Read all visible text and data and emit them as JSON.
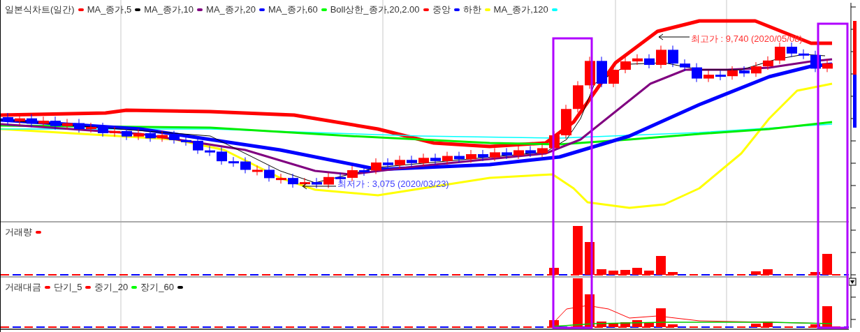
{
  "price_panel": {
    "legend": [
      {
        "label": "일본식차트(일간)",
        "color": "#ff0000"
      },
      {
        "label": "MA_종가,5",
        "color": "#000000"
      },
      {
        "label": "MA_종가,10",
        "color": "#800080"
      },
      {
        "label": "MA_종가,20",
        "color": "#0000ff"
      },
      {
        "label": "MA_종가,60",
        "color": "#00ff00"
      },
      {
        "label": "Boll상한_종가,20,2.00",
        "color": "#ff0000"
      },
      {
        "label": "중앙",
        "color": "#0000ff"
      },
      {
        "label": "하한",
        "color": "#ffff00"
      },
      {
        "label": "MA_종가,120",
        "color": "#00ffff"
      }
    ],
    "high_label": "최고가 : 9,740 (2020/05/08)",
    "low_label": "최저가 : 3,075 (2020/03/23)"
  },
  "volume_panel": {
    "legend": [
      {
        "label": "거래량",
        "color": "#ff0000"
      }
    ]
  },
  "amount_panel": {
    "legend": [
      {
        "label": "거래대금",
        "color": "#ff0000"
      },
      {
        "label": "단기_5",
        "color": "#ff0000"
      },
      {
        "label": "중기_20",
        "color": "#00ff00"
      },
      {
        "label": "장기_60",
        "color": "#000000"
      }
    ]
  }
}
